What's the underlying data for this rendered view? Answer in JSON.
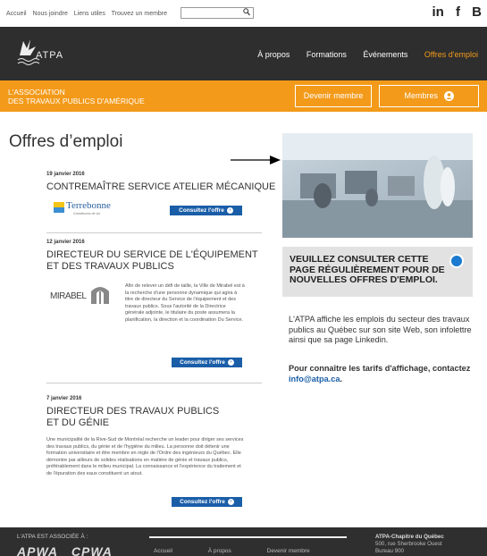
{
  "topbar": {
    "links": [
      "Accueil",
      "Nous joindre",
      "Liens utiles",
      "Trouvez un membre"
    ],
    "search_placeholder": "",
    "search_icon": "magnifier-icon",
    "social": [
      "in",
      "f",
      "B"
    ]
  },
  "nav": {
    "logo_text": "ATPA",
    "items": [
      "À propos",
      "Formations",
      "Événements",
      "Offres d'emploi"
    ],
    "active_color": "#f39a1a"
  },
  "band": {
    "line1": "L'ASSOCIATION",
    "line2": "DES TRAVAUX PUBLICS D'AMÉRIQUE",
    "devenir": "Devenir membre",
    "membres": "Membres",
    "color": "#f39a1a"
  },
  "page": {
    "title": "Offres d’emploi"
  },
  "jobs": [
    {
      "date": "19 janvier 2016",
      "title": "CONTREMAÎTRE SERVICE ATELIER MÉCANIQUE",
      "logo": "Terrebonne",
      "logo_sub": "Grandissons de soi",
      "button": "Consultez l'offre"
    },
    {
      "date": "12 janvier 2016",
      "title_l1": "DIRECTEUR DU SERVICE DE L'ÉQUIPEMENT",
      "title_l2": "ET DES TRAVAUX PUBLICS",
      "logo": "MIRABEL",
      "desc": "Afin de relever un défi de taille, la Ville de Mirabel est à la recherche d'une personne dynamique qui agira à titre de directeur du Service de l'équipement et des travaux publics. Sous l'autorité de la Directrice générale adjointe, le titulaire du poste assumera la planification, la direction et la coordination Du Service.",
      "button": "Consultez l'offre"
    },
    {
      "date": "7 janvier 2016",
      "title_l1": "DIRECTEUR DES TRAVAUX PUBLICS",
      "title_l2": "ET DU GÉNIE",
      "desc": "Une municipalité de la Rive-Sud de Montréal recherche un leader pour diriger ses services des travaux publics, du génie et de l'hygiène du milieu. La personne doit détenir une formation universitaire et être membre en règle de l'Ordre des ingénieurs du Québec. Elle démontre par ailleurs de solides réalisations en matière de génie et travaux publics, préférablement dans le milieu municipal. La connaissance et l'expérience du traitement et de l'épuration des eaux constituent un atout.",
      "button": "Consultez l'offre"
    }
  ],
  "sidebar": {
    "notice": "VEUILLEZ CONSULTER CETTE PAGE RÉGULIÈREMENT POUR DE NOUVELLES OFFRES D'EMPLOI.",
    "info": "L'ATPA affiche les emplois du secteur des travaux publics au Québec sur son site Web, son infolettre ainsi que sa page Linkedin.",
    "tarifs": "Pour connaître les tarifs d'affichage, contactez ",
    "email": "info@atpa.ca",
    "email_suffix": "."
  },
  "footer": {
    "assoc": "L'ATPA EST ASSOCIÉE À :",
    "logos": [
      "APWA",
      "CPWA"
    ],
    "nav": [
      "Accueil",
      "À propos",
      "Devenir membre"
    ],
    "org": "ATPA-Chapitre du Québec",
    "addr1": "500, rue Sherbrooke Ouest",
    "addr2": "Bureau 900"
  }
}
